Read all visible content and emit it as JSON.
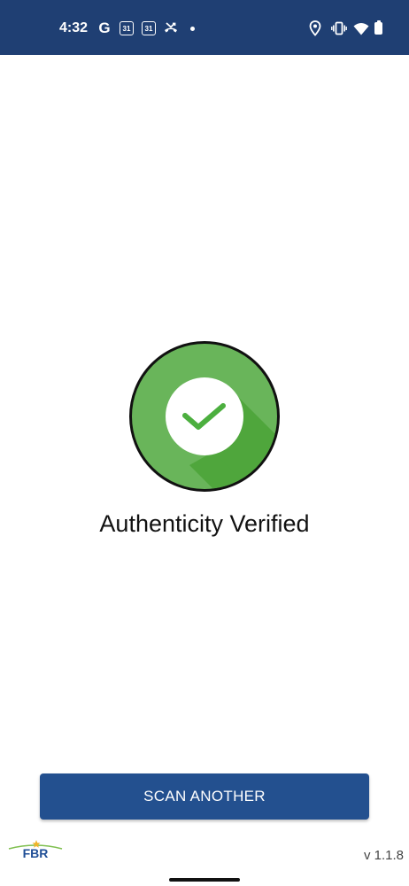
{
  "status_bar": {
    "time": "4:32",
    "google_icon_letter": "G",
    "calendar_day_1": "31",
    "calendar_day_2": "31",
    "icons": [
      "google-icon",
      "calendar-icon",
      "calendar-icon",
      "missed-call-icon",
      "notification-dot-icon",
      "location-icon",
      "vibrate-icon",
      "wifi-icon",
      "battery-icon"
    ]
  },
  "result": {
    "title": "Authenticity Verified",
    "icon": "check-icon"
  },
  "actions": {
    "scan_another_label": "SCAN ANOTHER"
  },
  "footer": {
    "logo_text": "FBR",
    "logo_tagline": "",
    "version": "v 1.1.8"
  },
  "colors": {
    "status_bar": "#1f3f73",
    "accent": "#23508f",
    "success": "#69b55a",
    "success_shadow": "#4fa63c",
    "check": "#4caf3f"
  }
}
